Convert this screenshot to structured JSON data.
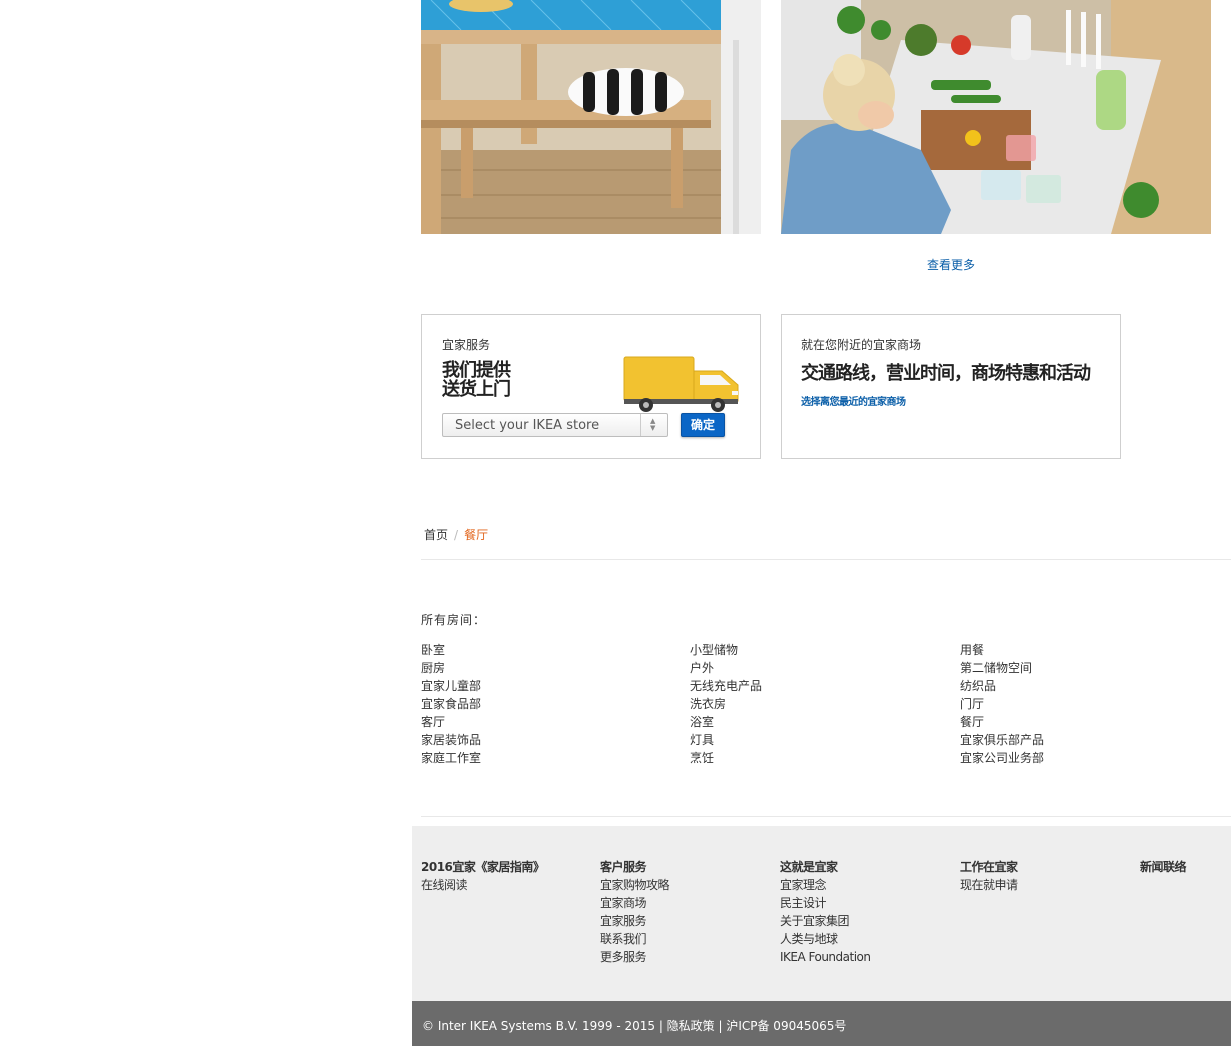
{
  "hero": {
    "more_label": "查看更多"
  },
  "service_box": {
    "kicker": "宜家服务",
    "headline_line1": "我们提供",
    "headline_line2": "送货上门",
    "select_value": "Select your IKEA store",
    "ok_label": "确定"
  },
  "store_box": {
    "kicker": "就在您附近的宜家商场",
    "headline": "交通路线，营业时间，商场特惠和活动",
    "link": "选择离您最近的宜家商场"
  },
  "breadcrumb": {
    "home": "首页",
    "separator": "/",
    "current": "餐厅"
  },
  "rooms": {
    "title": "所有房间：",
    "col1": [
      "卧室",
      "厨房",
      "宜家儿童部",
      "宜家食品部",
      "客厅",
      "家居装饰品",
      "家庭工作室"
    ],
    "col2": [
      "小型储物",
      "户外",
      "无线充电产品",
      "洗衣房",
      "浴室",
      "灯具",
      "烹饪"
    ],
    "col3": [
      "用餐",
      "第二储物空间",
      "纺织品",
      "门厅",
      "餐厅",
      "宜家俱乐部产品",
      "宜家公司业务部"
    ]
  },
  "footer": {
    "col1": {
      "heading": "2016宜家《家居指南》",
      "links": [
        "在线阅读"
      ]
    },
    "col2": {
      "heading": "客户服务",
      "links": [
        "宜家购物攻略",
        "宜家商场",
        "宜家服务",
        "联系我们",
        "更多服务"
      ]
    },
    "col3": {
      "heading": "这就是宜家",
      "links": [
        "宜家理念",
        "民主设计",
        "关于宜家集团",
        "人类与地球",
        "IKEA Foundation"
      ]
    },
    "col4": {
      "heading": "工作在宜家",
      "links": [
        "现在就申请"
      ]
    },
    "col5": {
      "heading": "新闻联络",
      "links": []
    }
  },
  "copyright": "© Inter IKEA Systems B.V. 1999 - 2015 | 隐私政策 | 沪ICP备 09045065号",
  "colors": {
    "link_blue": "#0a5ea8",
    "button_blue": "#0b66c6",
    "breadcrumb_current": "#e2661d",
    "footer_bg": "#eeeeee",
    "copyright_bg": "#6b6b6b",
    "truck_yellow": "#f2c230"
  }
}
